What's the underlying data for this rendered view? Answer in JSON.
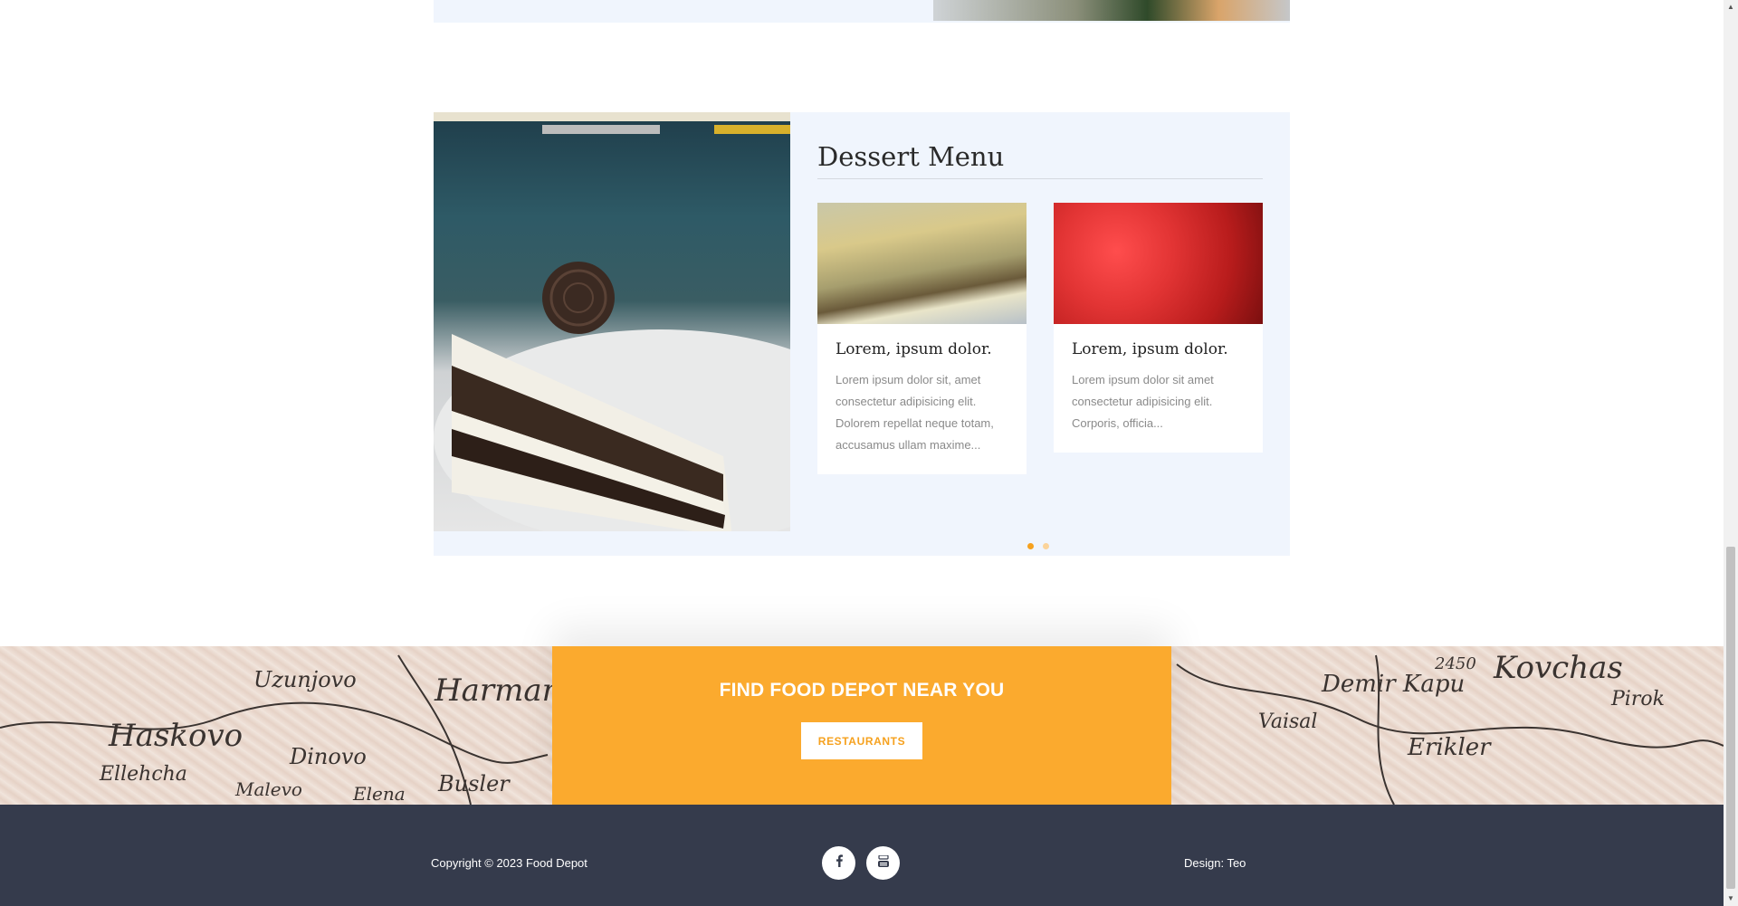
{
  "dessert_menu": {
    "title": "Dessert Menu",
    "cards": [
      {
        "title": "Lorem, ipsum dolor.",
        "text": "Lorem ipsum dolor sit, amet consectetur adipisicing elit. Dolorem repellat neque totam, accusamus ullam maxime..."
      },
      {
        "title": "Lorem, ipsum dolor.",
        "text": "Lorem ipsum dolor sit amet consectetur adipisicing elit. Corporis, officia..."
      }
    ],
    "carousel": {
      "pages": 2,
      "active_page": 1
    }
  },
  "cta": {
    "title": "FIND FOOD DEPOT NEAR YOU",
    "button_label": "RESTAURANTS"
  },
  "footer": {
    "copyright": "Copyright © 2023 Food Depot",
    "design_credit": "Design: Teo",
    "social": [
      "facebook-icon",
      "youtube-icon"
    ]
  },
  "map_labels": [
    "Harmanli",
    "Uzunjovo",
    "Haskovo",
    "Dinovo",
    "Ellehcha",
    "Malevo",
    "Elena",
    "Busler",
    "Demir Kapu",
    "Kovchas",
    "Erikler",
    "Vaisal",
    "Pirok",
    "2450"
  ],
  "colors": {
    "accent": "#f6a11e",
    "cta_background": "#fbaa2e",
    "section_background": "#f0f5fd",
    "footer_background": "#353b4c"
  }
}
